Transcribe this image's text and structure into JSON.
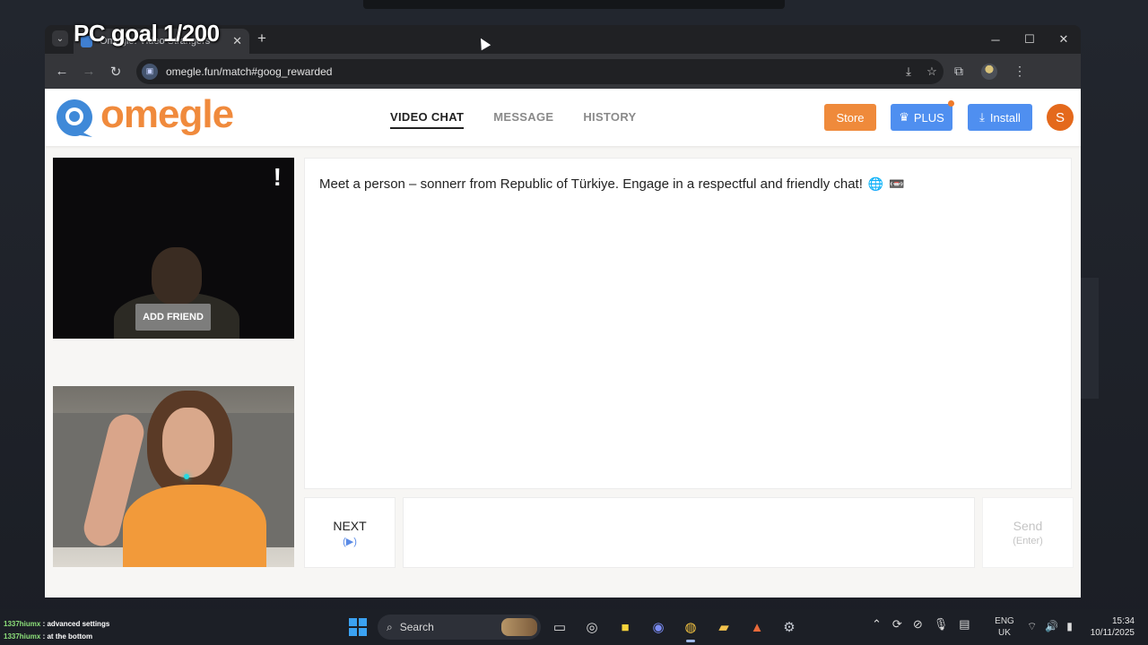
{
  "overlay": {
    "goal_text": "PC goal 1/200",
    "chat": [
      {
        "user": "1337hiumx",
        "text": ": advanced settings"
      },
      {
        "user": "1337hiumx",
        "text": ": at the bottom"
      }
    ]
  },
  "browser": {
    "tab_title": "Omegle: Video Strangers",
    "new_tab_icon": "+",
    "url": "omegle.fun/match#goog_rewarded"
  },
  "site": {
    "logo_text": "omegle",
    "nav": {
      "video_chat": "VIDEO CHAT",
      "message": "MESSAGE",
      "history": "HISTORY"
    },
    "store_label": "Store",
    "plus_label": "PLUS",
    "install_label": "Install",
    "avatar_initial": "S",
    "brand_color": "#f08a3c",
    "accent_blue": "#4f8ff0"
  },
  "video": {
    "report_mark": "!",
    "add_friend_label": "ADD FRIEND"
  },
  "chat": {
    "message": "Meet a person – sonnerr from Republic of Türkiye. Engage in a respectful and friendly chat!",
    "emoji_1": "🌐",
    "emoji_2": "📼",
    "next_label": "NEXT",
    "next_hint": "(▶)",
    "input_value": "",
    "send_label": "Send",
    "send_hint": "(Enter)"
  },
  "taskbar": {
    "search_placeholder": "Search",
    "lang_line1": "ENG",
    "lang_line2": "UK",
    "time": "15:34",
    "date": "10/11/2025"
  }
}
